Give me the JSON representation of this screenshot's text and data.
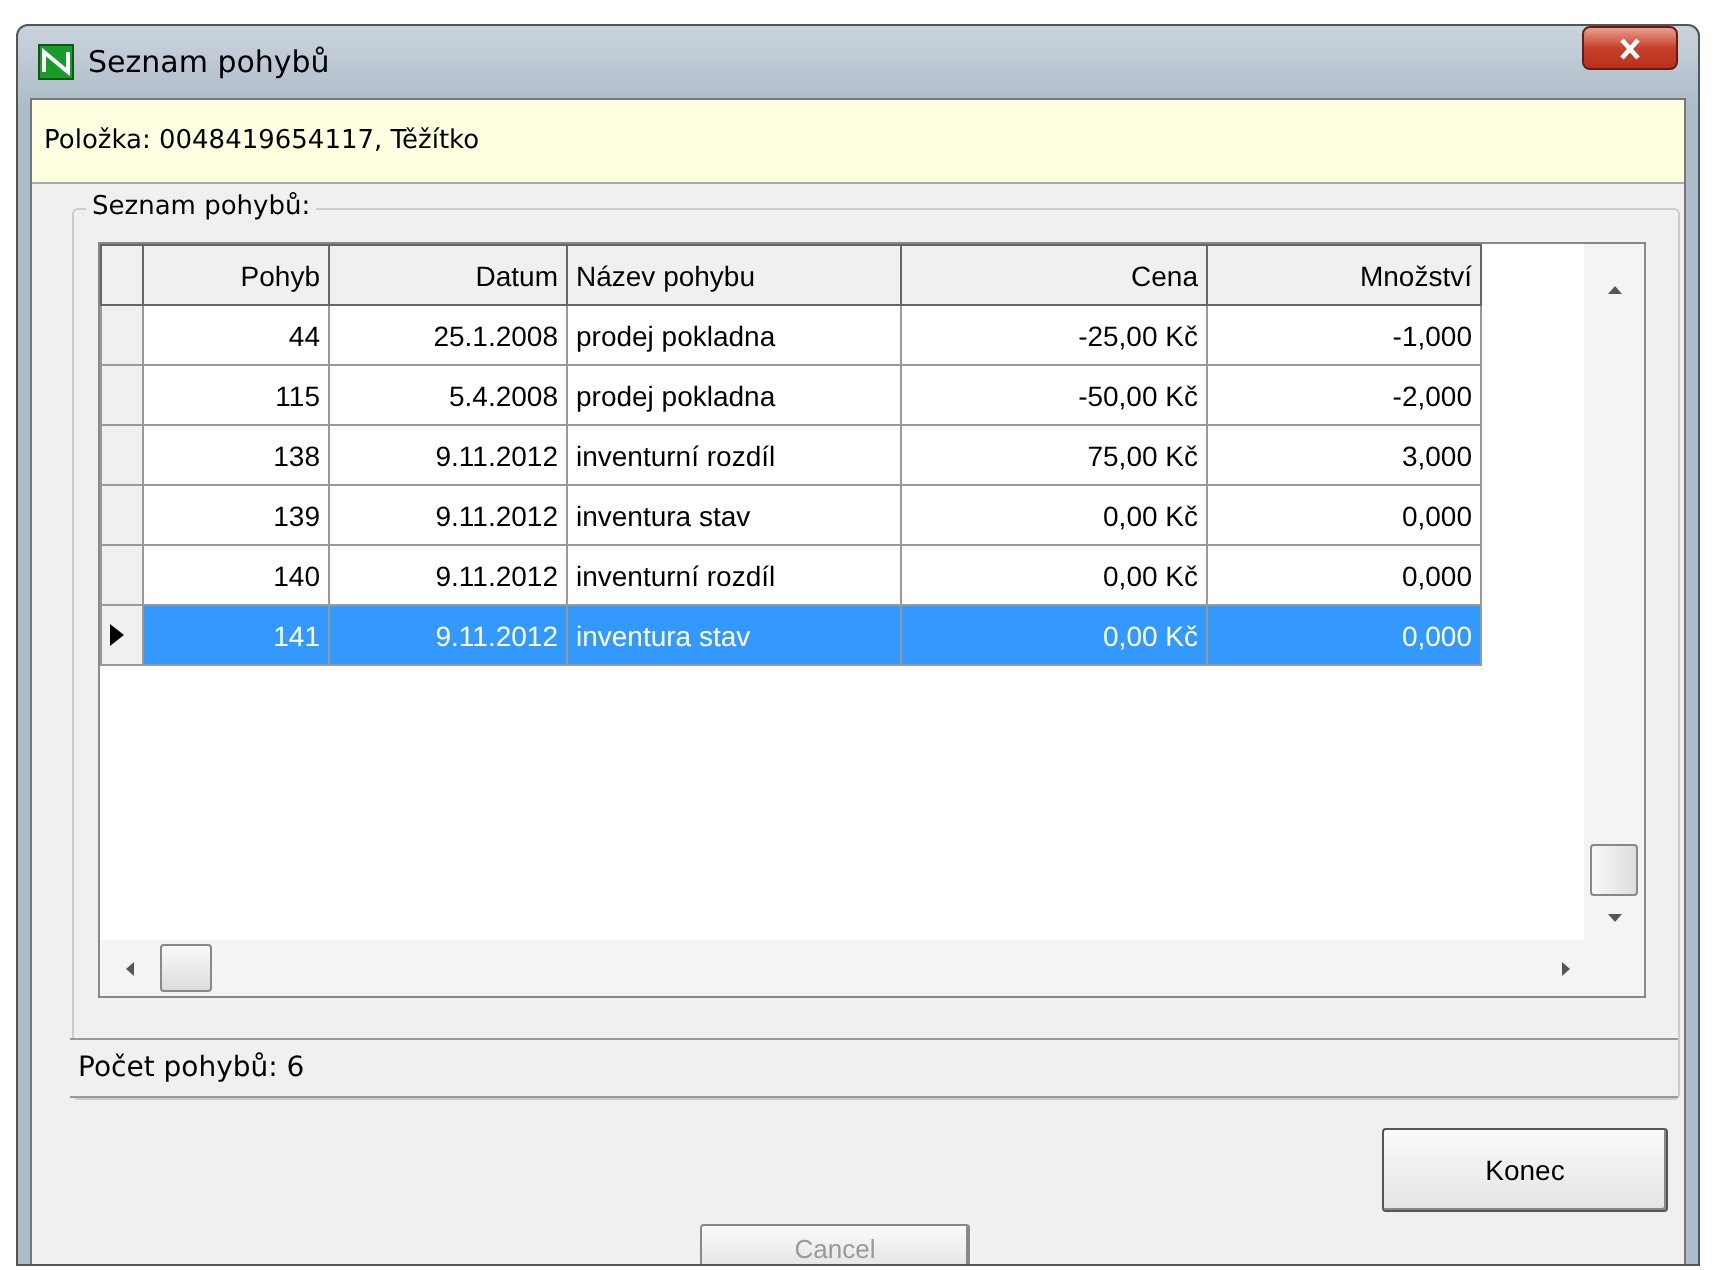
{
  "window": {
    "title": "Seznam pohybů"
  },
  "info": "Položka: 0048419654117, Těžítko",
  "group": {
    "label": "Seznam pohybů:"
  },
  "table": {
    "columns": [
      "Pohyb",
      "Datum",
      "Název pohybu",
      "Cena",
      "Množství"
    ],
    "rows": [
      {
        "cells": [
          "44",
          "25.1.2008",
          "prodej pokladna",
          "-25,00 Kč",
          "-1,000"
        ],
        "selected": false
      },
      {
        "cells": [
          "115",
          "5.4.2008",
          "prodej pokladna",
          "-50,00 Kč",
          "-2,000"
        ],
        "selected": false
      },
      {
        "cells": [
          "138",
          "9.11.2012",
          "inventurní rozdíl",
          "75,00 Kč",
          "3,000"
        ],
        "selected": false
      },
      {
        "cells": [
          "139",
          "9.11.2012",
          "inventura stav",
          "0,00 Kč",
          "0,000"
        ],
        "selected": false
      },
      {
        "cells": [
          "140",
          "9.11.2012",
          "inventurní rozdíl",
          "0,00 Kč",
          "0,000"
        ],
        "selected": false
      },
      {
        "cells": [
          "141",
          "9.11.2012",
          "inventura stav",
          "0,00 Kč",
          "0,000"
        ],
        "selected": true
      }
    ]
  },
  "status_bar": "Počet pohybů: 6",
  "buttons": [
    "Konec",
    "Cancel"
  ]
}
